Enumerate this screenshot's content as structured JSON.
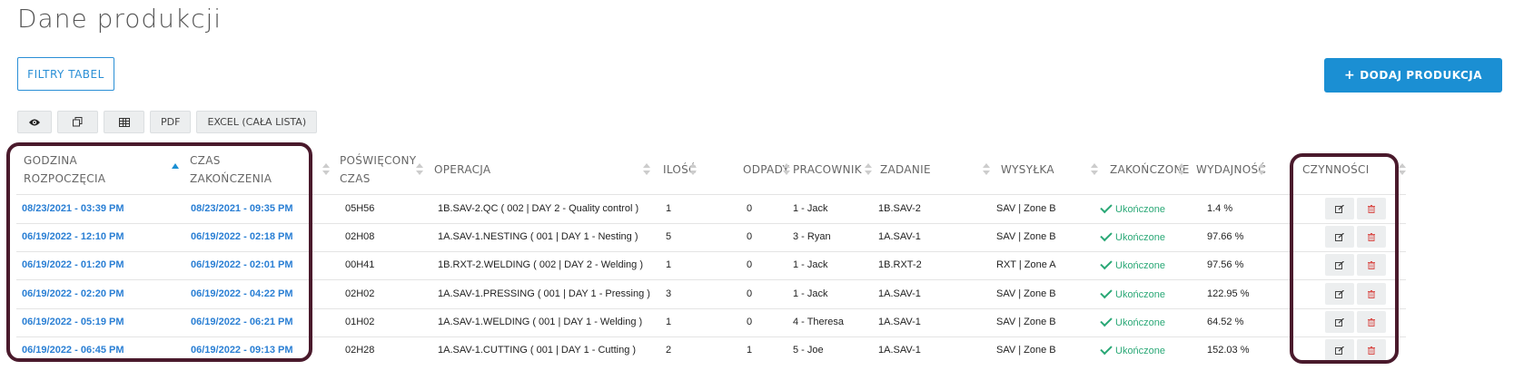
{
  "page": {
    "title": "Dane produkcji"
  },
  "buttons": {
    "filters": "FILTRY TABEL",
    "add_plus": "+",
    "add": "DODAJ PRODUKCJA"
  },
  "toolbar": {
    "pdf": "PDF",
    "excel": "EXCEL (CAŁA LISTA)"
  },
  "table": {
    "headers": {
      "start_line1": "GODZINA",
      "start_line2": "ROZPOCZĘCIA",
      "end_line1": "CZAS",
      "end_line2": "ZAKOŃCZENIA",
      "spent_line1": "POŚWIĘCONY",
      "spent_line2": "CZAS",
      "operation": "OPERACJA",
      "qty": "ILOŚĆ",
      "waste": "ODPADY",
      "worker": "PRACOWNIK",
      "task": "ZADANIE",
      "shipping": "WYSYŁKA",
      "finished": "ZAKOŃCZONE",
      "efficiency": "WYDAJNOŚĆ",
      "actions": "CZYNNOŚCI"
    },
    "rows": [
      {
        "start": "08/23/2021 - 03:39 PM",
        "end": "08/23/2021 - 09:35 PM",
        "spent": "05H56",
        "operation": "1B.SAV-2.QC ( 002 | DAY 2 - Quality control )",
        "qty": "1",
        "waste": "0",
        "worker": "1 - Jack",
        "task": "1B.SAV-2",
        "shipping": "SAV | Zone B",
        "finished": "Ukończone",
        "efficiency": "1.4 %"
      },
      {
        "start": "06/19/2022 - 12:10 PM",
        "end": "06/19/2022 - 02:18 PM",
        "spent": "02H08",
        "operation": "1A.SAV-1.NESTING ( 001 | DAY 1 - Nesting )",
        "qty": "5",
        "waste": "0",
        "worker": "3 - Ryan",
        "task": "1A.SAV-1",
        "shipping": "SAV | Zone B",
        "finished": "Ukończone",
        "efficiency": "97.66 %"
      },
      {
        "start": "06/19/2022 - 01:20 PM",
        "end": "06/19/2022 - 02:01 PM",
        "spent": "00H41",
        "operation": "1B.RXT-2.WELDING ( 002 | DAY 2 - Welding )",
        "qty": "1",
        "waste": "0",
        "worker": "1 - Jack",
        "task": "1B.RXT-2",
        "shipping": "RXT | Zone A",
        "finished": "Ukończone",
        "efficiency": "97.56 %"
      },
      {
        "start": "06/19/2022 - 02:20 PM",
        "end": "06/19/2022 - 04:22 PM",
        "spent": "02H02",
        "operation": "1A.SAV-1.PRESSING ( 001 | DAY 1 - Pressing )",
        "qty": "3",
        "waste": "0",
        "worker": "1 - Jack",
        "task": "1A.SAV-1",
        "shipping": "SAV | Zone B",
        "finished": "Ukończone",
        "efficiency": "122.95 %"
      },
      {
        "start": "06/19/2022 - 05:19 PM",
        "end": "06/19/2022 - 06:21 PM",
        "spent": "01H02",
        "operation": "1A.SAV-1.WELDING ( 001 | DAY 1 - Welding )",
        "qty": "1",
        "waste": "0",
        "worker": "4 - Theresa",
        "task": "1A.SAV-1",
        "shipping": "SAV | Zone B",
        "finished": "Ukończone",
        "efficiency": "64.52 %"
      },
      {
        "start": "06/19/2022 - 06:45 PM",
        "end": "06/19/2022 - 09:13 PM",
        "spent": "02H28",
        "operation": "1A.SAV-1.CUTTING ( 001 | DAY 1 - Cutting )",
        "qty": "2",
        "waste": "1",
        "worker": "5 - Joe",
        "task": "1A.SAV-1",
        "shipping": "SAV | Zone B",
        "finished": "Ukończone",
        "efficiency": "152.03 %"
      }
    ]
  },
  "colors": {
    "accent": "#1b8fd3",
    "link": "#2a7fd4",
    "success": "#2aa876",
    "delete": "#d9534f",
    "highlight": "#4a1a2c"
  },
  "icons": {
    "view": "eye-icon",
    "copy": "copy-icon",
    "columns": "table-icon",
    "edit": "edit-icon",
    "delete": "trash-icon",
    "done": "check-icon"
  }
}
